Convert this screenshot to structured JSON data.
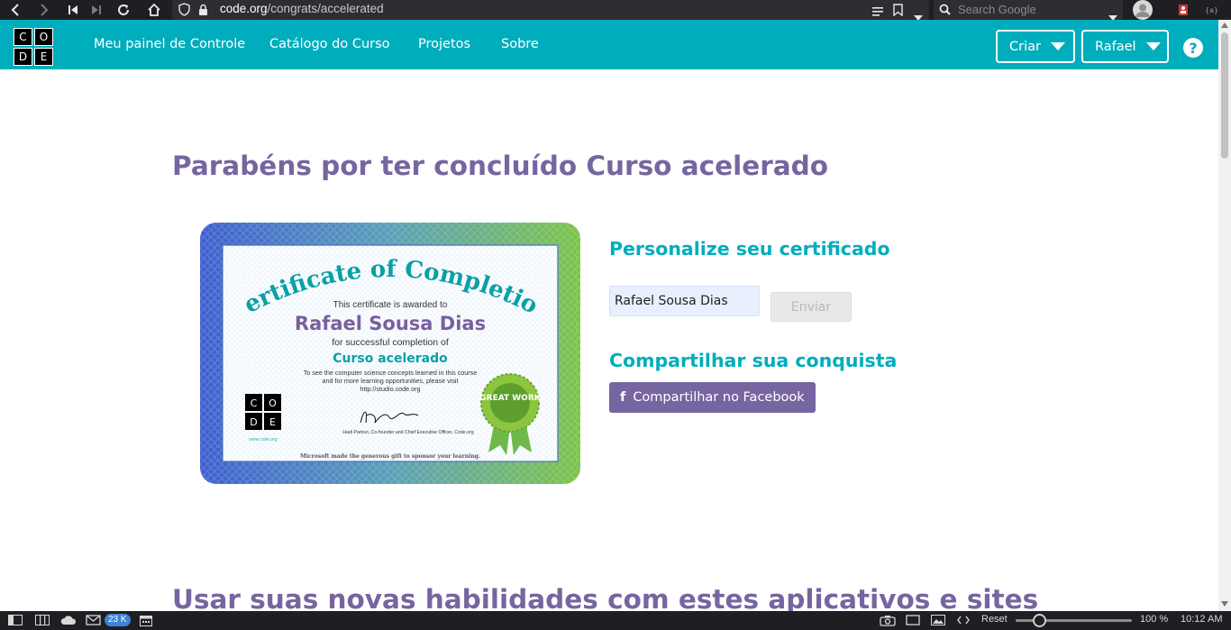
{
  "browser": {
    "url_host": "code.org",
    "url_path": "/congrats/accelerated",
    "search_placeholder": "Search Google"
  },
  "site": {
    "logo_letters": [
      "C",
      "O",
      "D",
      "E"
    ],
    "nav_links": [
      "Meu painel de Controle",
      "Catálogo do Curso",
      "Projetos",
      "Sobre"
    ],
    "create_label": "Criar",
    "user_label": "Rafael",
    "help_glyph": "?"
  },
  "main": {
    "title": "Parabéns por ter concluído Curso acelerado",
    "customize_heading": "Personalize seu certificado",
    "name_value": "Rafael Sousa Dias",
    "submit_label": "Enviar",
    "share_heading": "Compartilhar sua conquista",
    "facebook_label": "Compartilhar no Facebook",
    "bottom_title": "Usar suas novas habilidades com estes aplicativos e sites"
  },
  "certificate": {
    "title": "Certificate of Completion",
    "awarded": "This certificate is awarded to",
    "name": "Rafael Sousa Dias",
    "for": "for successful completion of",
    "course": "Curso acelerado",
    "body1": "To see the computer science concepts learned in this course",
    "body2": "and for more learning opportunities, please visit",
    "body3": "http://studio.code.org",
    "seal": "GREAT WORK",
    "signer": "Hadi Partovi, Co-founder and Chief Executive Officer, Code.org",
    "footer": "Microsoft made the generous gift to sponsor your learning.",
    "website": "www.code.org"
  },
  "status_bar": {
    "mail_count": "23 K",
    "reset_label": "Reset",
    "zoom": "100 %",
    "time": "10:12 AM"
  },
  "colors": {
    "teal": "#00adbc",
    "purple": "#7665a0",
    "dark_chrome": "#1f1f23"
  }
}
